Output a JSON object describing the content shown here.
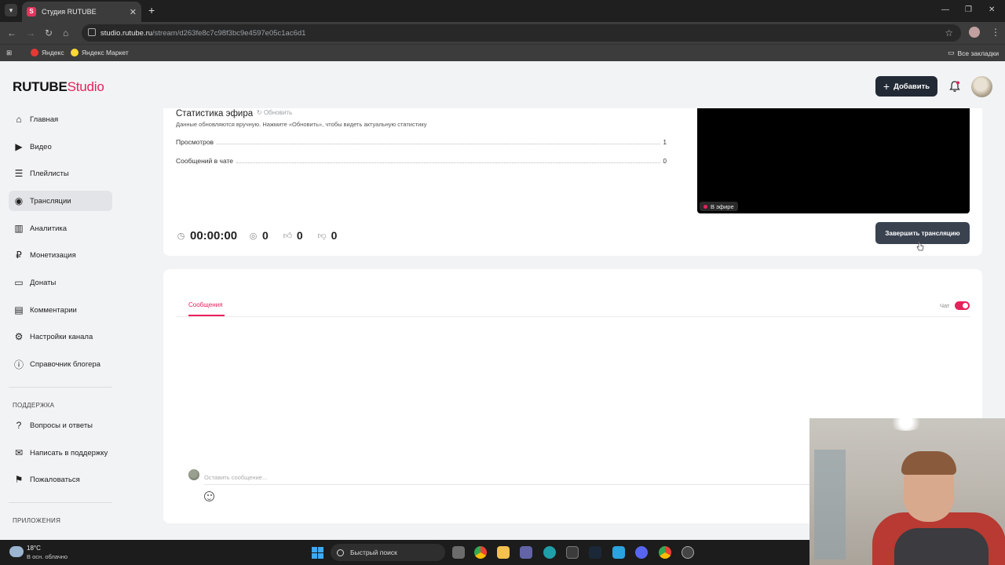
{
  "browser": {
    "tab_title": "Студия RUTUBE",
    "tab_favicon": "S",
    "url_host": "studio.rutube.ru",
    "url_path": "/stream/d263fe8c7c98f3bc9e4597e05c1ac6d1",
    "bookmarks": [
      "Яндекс",
      "Яндекс Маркет"
    ],
    "all_bookmarks": "Все закладки"
  },
  "header": {
    "logo_main": "RUTUBE",
    "logo_accent": "Studio",
    "add_button": "Добавить"
  },
  "sidebar": {
    "items": [
      {
        "label": "Главная",
        "icon": "home-icon"
      },
      {
        "label": "Видео",
        "icon": "video-icon"
      },
      {
        "label": "Плейлисты",
        "icon": "playlist-icon"
      },
      {
        "label": "Трансляции",
        "icon": "broadcast-icon",
        "active": true
      },
      {
        "label": "Аналитика",
        "icon": "analytics-icon"
      },
      {
        "label": "Монетизация",
        "icon": "ruble-icon"
      },
      {
        "label": "Донаты",
        "icon": "wallet-icon"
      },
      {
        "label": "Комментарии",
        "icon": "comment-icon"
      },
      {
        "label": "Настройки канала",
        "icon": "gear-icon"
      },
      {
        "label": "Справочник блогера",
        "icon": "info-icon"
      }
    ],
    "support_heading": "ПОДДЕРЖКА",
    "support_items": [
      {
        "label": "Вопросы и ответы",
        "icon": "question-icon"
      },
      {
        "label": "Написать в поддержку",
        "icon": "mail-icon"
      },
      {
        "label": "Пожаловаться",
        "icon": "flag-icon"
      }
    ],
    "apps_heading": "ПРИЛОЖЕНИЯ"
  },
  "stats": {
    "title": "Статистика эфира",
    "refresh_label": "Обновить",
    "note": "Данные обновляются вручную. Нажмите «Обновить», чтобы видеть актуальную статистику",
    "rows": [
      {
        "label": "Просмотров",
        "value": "1"
      },
      {
        "label": "Сообщений в чате",
        "value": "0"
      }
    ],
    "live_badge": "В эфире",
    "timer": "00:00:00",
    "viewers": "0",
    "likes": "0",
    "dislikes": "0",
    "end_button": "Завершить трансляцию"
  },
  "chat": {
    "tab_label": "Сообщения",
    "toggle_label": "Чат",
    "toggle_on": true,
    "input_placeholder": "Оставить сообщение..."
  },
  "taskbar": {
    "temperature": "18°C",
    "weather": "В осн. облачно",
    "search_label": "Быстрый поиск"
  },
  "colors": {
    "accent": "#e8215b",
    "dark_button": "#222a35"
  }
}
